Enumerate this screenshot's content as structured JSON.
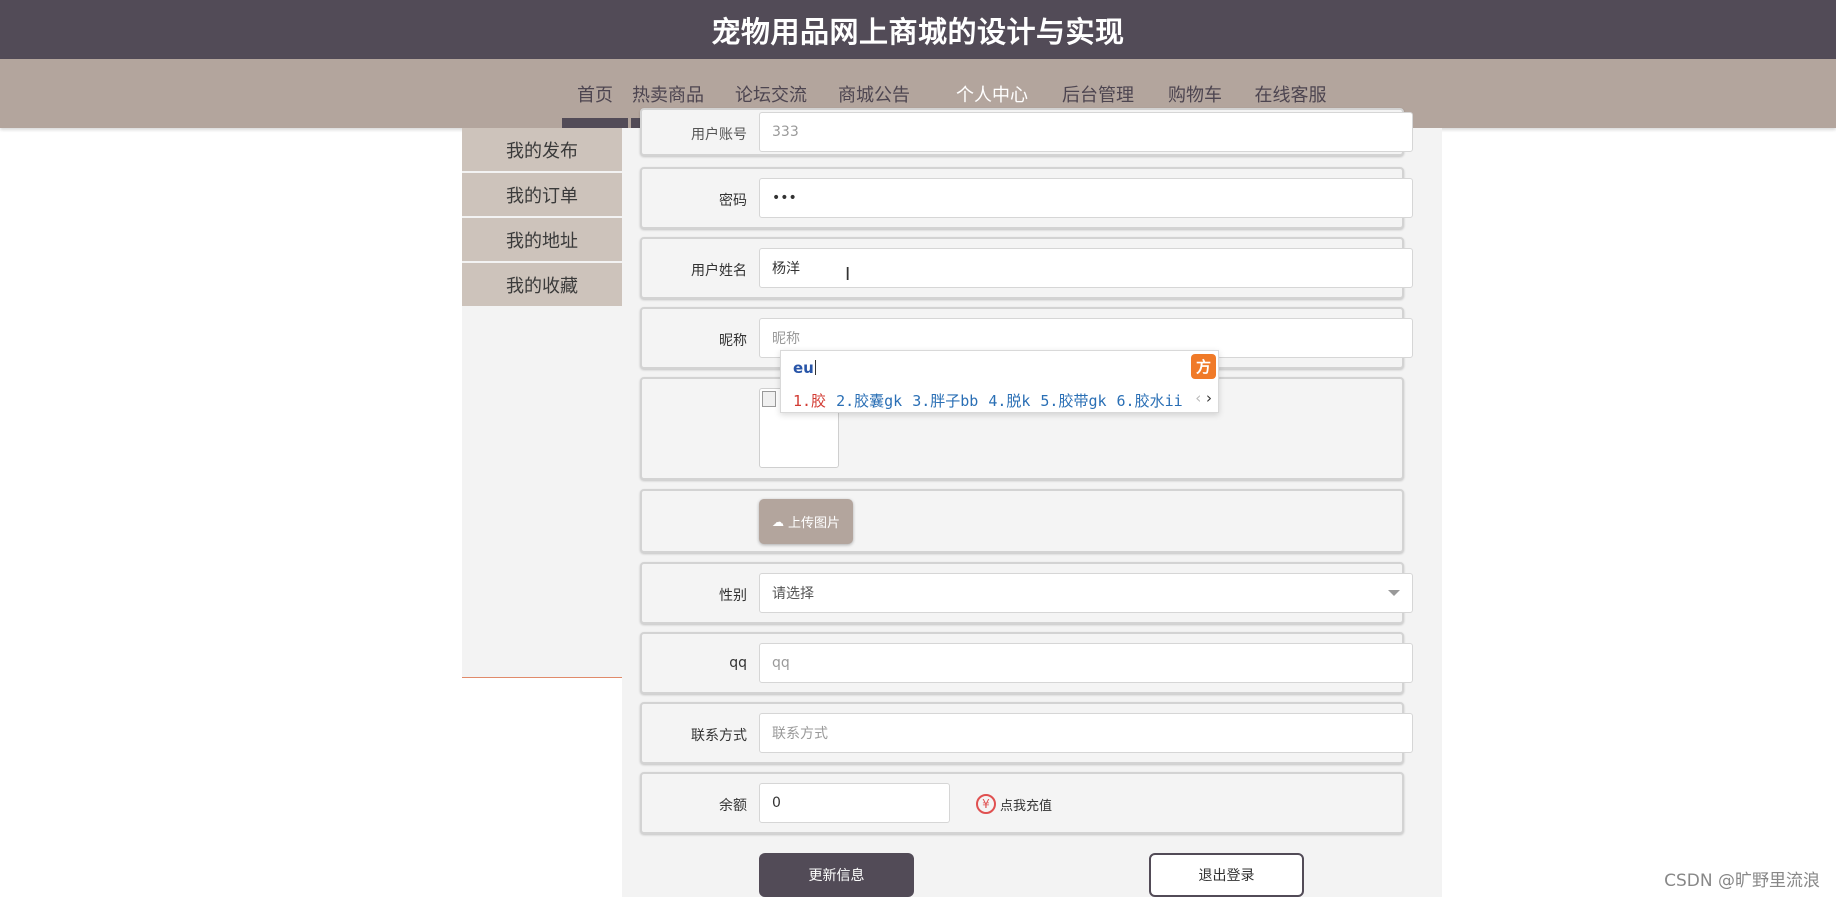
{
  "header": {
    "title": "宠物用品网上商城的设计与实现"
  },
  "nav": {
    "items": [
      "首页",
      "热卖商品",
      "论坛交流",
      "商城公告",
      "个人中心",
      "后台管理",
      "购物车",
      "在线客服"
    ],
    "active": "个人中心"
  },
  "sidebar": {
    "items": [
      "我的发布",
      "我的订单",
      "我的地址",
      "我的收藏"
    ]
  },
  "form": {
    "account": {
      "label": "用户账号",
      "value": "333"
    },
    "password": {
      "label": "密码",
      "value": "•••"
    },
    "name": {
      "label": "用户姓名",
      "value": "杨洋"
    },
    "nickname": {
      "label": "昵称",
      "placeholder": "昵称"
    },
    "upload_label": "上传图片",
    "gender": {
      "label": "性别",
      "placeholder": "请选择"
    },
    "qq": {
      "label": "qq",
      "placeholder": "qq"
    },
    "contact": {
      "label": "联系方式",
      "placeholder": "联系方式"
    },
    "balance": {
      "label": "余额",
      "value": "0",
      "recharge": "点我充值",
      "recharge_icon": "¥"
    }
  },
  "buttons": {
    "update": "更新信息",
    "logout": "退出登录"
  },
  "ime": {
    "composition": "eu",
    "logo": "方",
    "candidates": [
      "1.胶",
      "2.胶囊gk",
      "3.胖子bb",
      "4.脱k",
      "5.胶带gk",
      "6.胶水ii"
    ],
    "prev": "‹",
    "next": "›"
  },
  "watermark": "CSDN @旷野里流浪",
  "colors": {
    "header_bg": "#524b57",
    "nav_bg": "#b3a59d",
    "sidebar_item_bg": "#cdc3bb",
    "accent": "#524b57"
  }
}
